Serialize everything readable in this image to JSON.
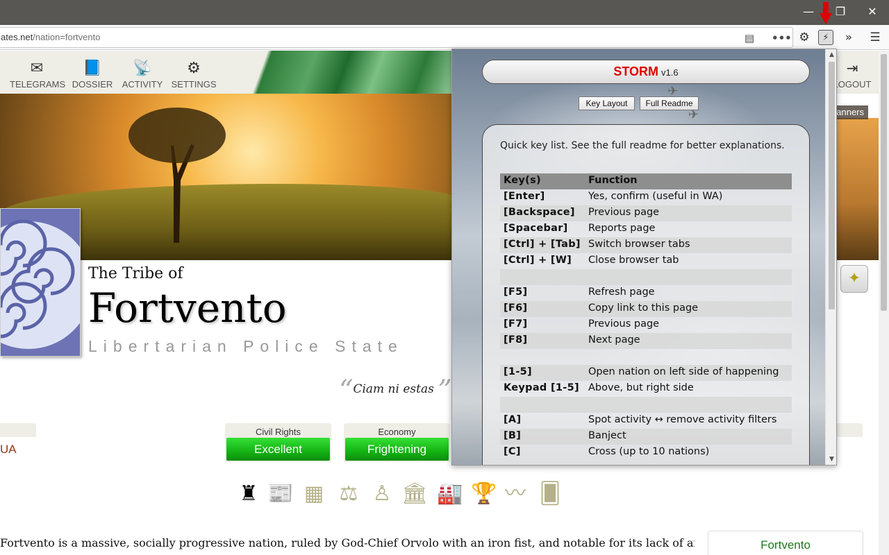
{
  "browser": {
    "url_host": "ates.net",
    "url_path": "/nation=fortvento",
    "window_controls": {
      "minimize": "—",
      "restore": "❐",
      "close": "✕"
    }
  },
  "nav": {
    "items": [
      {
        "label": "TELEGRAMS",
        "icon": "envelope-icon",
        "glyph": "✉"
      },
      {
        "label": "DOSSIER",
        "icon": "book-icon",
        "glyph": "📘"
      },
      {
        "label": "ACTIVITY",
        "icon": "satellite-dish-icon",
        "glyph": "📡"
      },
      {
        "label": "SETTINGS",
        "icon": "gears-icon",
        "glyph": "⚙"
      }
    ],
    "logout": "LOGOUT",
    "banners": "anners"
  },
  "nation": {
    "pretitle": "The Tribe of",
    "name": "Fortvento",
    "category": "Libertarian Police State",
    "motto": "Ciam ni estas",
    "wa_label": "UA",
    "description": "Fortvento is a massive, socially progressive nation, ruled by God-Chief Orvolo with an iron fist, and notable for its lack of airports,",
    "sidebox": "Fortvento"
  },
  "stats": [
    {
      "label": "Civil Rights",
      "value": "Excellent"
    },
    {
      "label": "Economy",
      "value": "Frightening"
    }
  ],
  "icon_row": [
    "pillar-icon",
    "newspaper-icon",
    "document-icon",
    "scales-icon",
    "person-icon",
    "government-building-icon",
    "factory-icon",
    "trophy-icon",
    "trend-icon",
    "cards-icon"
  ],
  "storm": {
    "title": "STORM",
    "version": "v1.6",
    "buttons": {
      "key_layout": "Key Layout",
      "full_readme": "Full Readme"
    },
    "intro": "Quick key list. See the full readme for better explanations.",
    "table_header": {
      "keys": "Key(s)",
      "function": "Function"
    },
    "rows": [
      {
        "key": "[Enter]",
        "fn": "Yes, confirm (useful in WA)"
      },
      {
        "key": "[Backspace]",
        "fn": "Previous page"
      },
      {
        "key": "[Spacebar]",
        "fn": "Reports page"
      },
      {
        "key": "[Ctrl] + [Tab]",
        "fn": "Switch browser tabs"
      },
      {
        "key": "[Ctrl] + [W]",
        "fn": "Close browser tab"
      },
      {
        "key": "",
        "fn": ""
      },
      {
        "key": "[F5]",
        "fn": "Refresh page"
      },
      {
        "key": "[F6]",
        "fn": "Copy link to this page"
      },
      {
        "key": "[F7]",
        "fn": "Previous page"
      },
      {
        "key": "[F8]",
        "fn": "Next page"
      },
      {
        "key": "",
        "fn": ""
      },
      {
        "key": "[1-5]",
        "fn": "Open nation on left side of happening"
      },
      {
        "key": "Keypad [1-5]",
        "fn": "Above, but right side"
      },
      {
        "key": "",
        "fn": ""
      },
      {
        "key": "[A]",
        "fn": "Spot activity ↔ remove activity filters"
      },
      {
        "key": "[B]",
        "fn": "Banject"
      },
      {
        "key": "[C]",
        "fn": "Cross (up to 10 nations)"
      }
    ]
  },
  "colors": {
    "storm_red": "#e00000",
    "stat_green": "#14b314",
    "titlebar": "#595753",
    "arrow_red": "#e00000"
  }
}
